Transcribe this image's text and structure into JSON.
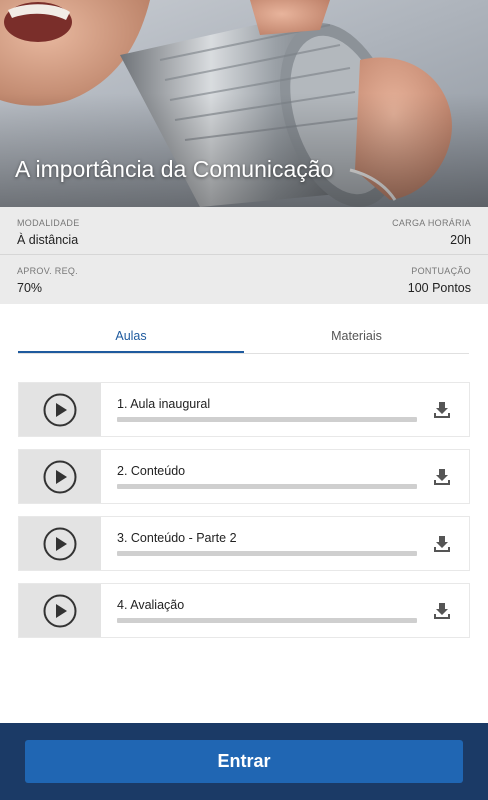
{
  "course": {
    "title": "A importância da Comunicação"
  },
  "info": {
    "modalidade": {
      "label": "MODALIDADE",
      "value": "À distância"
    },
    "carga": {
      "label": "CARGA HORÁRIA",
      "value": "20h"
    },
    "aprov": {
      "label": "APROV. REQ.",
      "value": "70%"
    },
    "pontuacao": {
      "label": "PONTUAÇÃO",
      "value": "100 Pontos"
    }
  },
  "tabs": [
    {
      "label": "Aulas",
      "active": true
    },
    {
      "label": "Materiais",
      "active": false
    }
  ],
  "lessons": [
    {
      "title": "1. Aula inaugural",
      "progress": 0,
      "icon": "play-icon",
      "action_icon": "download-icon"
    },
    {
      "title": "2. Conteúdo",
      "progress": 0,
      "icon": "play-icon",
      "action_icon": "download-icon"
    },
    {
      "title": "3. Conteúdo - Parte 2",
      "progress": 0,
      "icon": "play-icon",
      "action_icon": "download-icon"
    },
    {
      "title": "4. Avaliação",
      "progress": 0,
      "icon": "play-icon",
      "action_icon": "download-icon"
    }
  ],
  "footer": {
    "enter_label": "Entrar"
  },
  "colors": {
    "accent": "#1e5a9e",
    "footer_bg": "#1b3a66",
    "button_bg": "#2066b3"
  }
}
